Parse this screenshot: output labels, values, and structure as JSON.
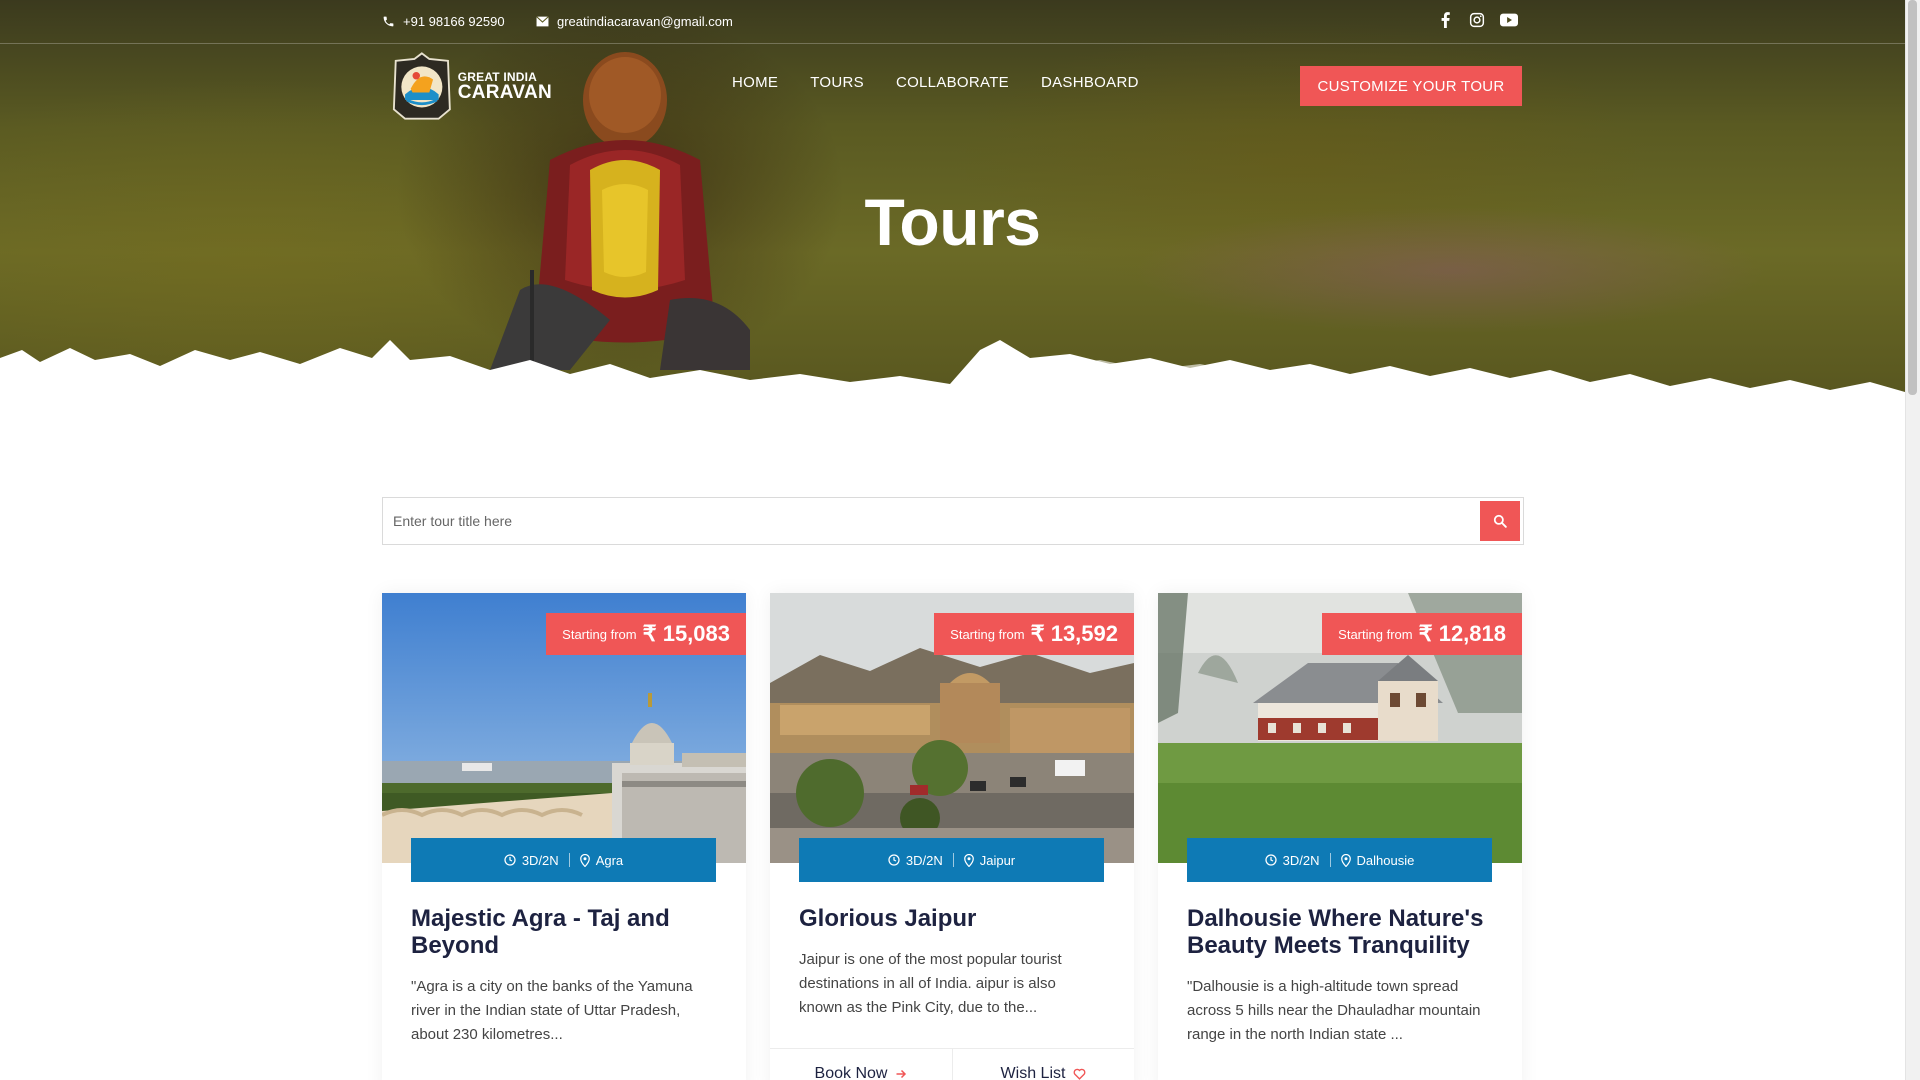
{
  "topbar": {
    "phone": "+91 98166 92590",
    "email": "greatindiacaravan@gmail.com",
    "social": [
      "facebook-icon",
      "instagram-icon",
      "youtube-icon"
    ]
  },
  "logo": {
    "line1": "GREAT INDIA",
    "line2": "CARAVAN"
  },
  "nav": {
    "items": [
      {
        "label": "HOME"
      },
      {
        "label": "TOURS"
      },
      {
        "label": "COLLABORATE"
      },
      {
        "label": "DASHBOARD"
      }
    ],
    "cta": "CUSTOMIZE YOUR TOUR"
  },
  "hero": {
    "title": "Tours"
  },
  "search": {
    "placeholder": "Enter tour title here",
    "icon": "search-icon"
  },
  "colors": {
    "accent": "#f05656",
    "info_bar": "#0e7ab5",
    "heading": "#1d2240"
  },
  "cards": [
    {
      "price_label": "Starting from",
      "price": "₹ 15,083",
      "duration": "3D/2N",
      "location": "Agra",
      "title": "Majestic Agra - Taj and Beyond",
      "description": "\"Agra is a city on the banks of the Yamuna river in the Indian state of Uttar Pradesh, about 230 kilometres..."
    },
    {
      "price_label": "Starting from",
      "price": "₹ 13,592",
      "duration": "3D/2N",
      "location": "Jaipur",
      "title": "Glorious Jaipur",
      "description": "Jaipur is one of the most popular tourist destinations in all of India. aipur is also known as the Pink City, due to the...",
      "book_label": "Book Now",
      "wish_label": "Wish List"
    },
    {
      "price_label": "Starting from",
      "price": "₹ 12,818",
      "duration": "3D/2N",
      "location": "Dalhousie",
      "title": "Dalhousie Where Nature's Beauty Meets Tranquility",
      "description": "\"Dalhousie is a high-altitude town spread across 5 hills near the Dhauladhar mountain range in the north Indian state ..."
    }
  ]
}
